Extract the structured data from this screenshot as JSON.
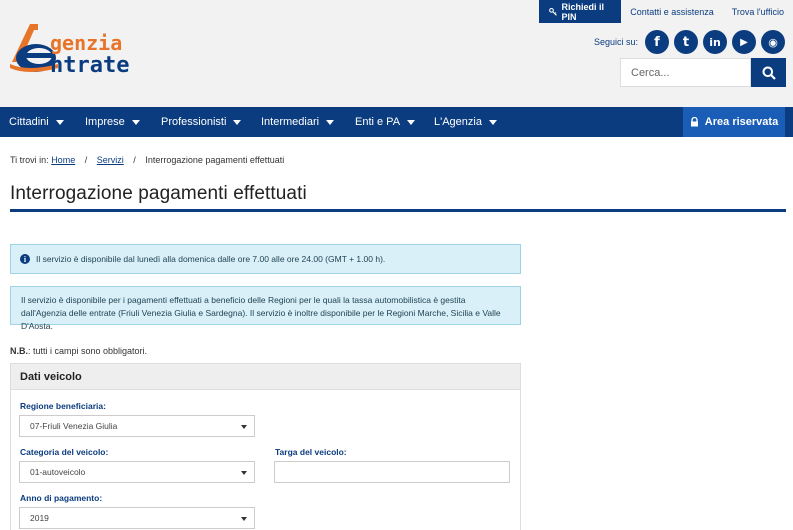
{
  "topbar": {
    "pin_label": "Richiedi il PIN",
    "contatti_label": "Contatti e assistenza",
    "ufficio_label": "Trova l'ufficio"
  },
  "logo": {
    "line1": "genzia",
    "line2": "ntrate"
  },
  "social": {
    "label": "Seguici su:",
    "items": [
      {
        "name": "facebook-icon",
        "glyph": "f"
      },
      {
        "name": "twitter-icon",
        "glyph": "t"
      },
      {
        "name": "linkedin-icon",
        "glyph": "in"
      },
      {
        "name": "youtube-icon",
        "glyph": "▶"
      },
      {
        "name": "rss-icon",
        "glyph": "◉"
      }
    ]
  },
  "search": {
    "placeholder": "Cerca..."
  },
  "nav": {
    "items": [
      {
        "label": "Cittadini"
      },
      {
        "label": "Imprese"
      },
      {
        "label": "Professionisti"
      },
      {
        "label": "Intermediari"
      },
      {
        "label": "Enti e PA"
      },
      {
        "label": "L'Agenzia"
      }
    ],
    "area_label": "Area riservata"
  },
  "breadcrumb": {
    "prefix": "Ti trovi in:",
    "home": "Home",
    "servizi": "Servizi",
    "current": "Interrogazione pagamenti effettuati"
  },
  "page": {
    "title": "Interrogazione pagamenti effettuati"
  },
  "alerts": {
    "orario": "Il servizio è disponibile dal lunedì alla domenica dalle ore 7.00 alle ore 24.00 (GMT + 1.00 h).",
    "regioni": "Il servizio è disponibile per i pagamenti effettuati a beneficio delle Regioni per le quali la tassa automobilistica è gestita dall'Agenzia delle entrate (Friuli Venezia Giulia e Sardegna). Il servizio è inoltre disponibile per le Regioni Marche, Sicilia e Valle D'Aosta."
  },
  "note": {
    "bold": "N.B.",
    "text": ": tutti i campi sono obbligatori."
  },
  "form": {
    "section_title": "Dati veicolo",
    "regione_label": "Regione beneficiaria:",
    "regione_value": "07-Friuli Venezia Giulia",
    "categoria_label": "Categoria del veicolo:",
    "categoria_value": "01-autoveicolo",
    "targa_label": "Targa del veicolo:",
    "targa_value": "",
    "anno_label": "Anno di pagamento:",
    "anno_value": "2019"
  },
  "colors": {
    "brand_blue": "#0b3c80",
    "accent_orange": "#e8742a",
    "alert_bg": "#d9f0f8"
  }
}
